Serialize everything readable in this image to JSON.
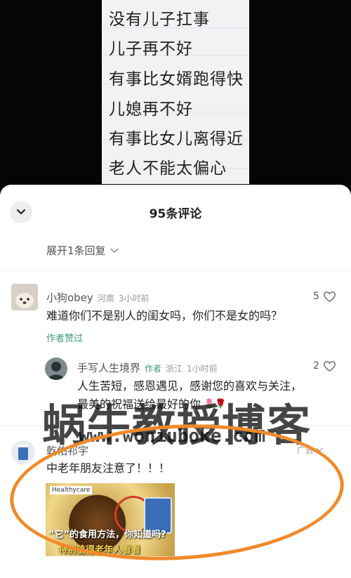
{
  "video": {
    "lines": [
      "没有儿子扛事",
      "儿子再不好",
      "有事比女婿跑得快",
      "儿媳再不好",
      "有事比女儿离得近",
      "老人不能太偏心"
    ]
  },
  "sheet": {
    "title": "95条评论",
    "expand_replies": "展开1条回复"
  },
  "comments": [
    {
      "user": "小狗obey",
      "region": "河南",
      "time": "3小时前",
      "likes": "5",
      "text": "难道你们不是别人的闺女吗，你们不是女的吗？",
      "author_liked": "作者赞过"
    }
  ],
  "reply": {
    "user": "手写人生境界",
    "author_tag": "作者",
    "region": "浙江",
    "time": "1小时前",
    "likes": "2",
    "text_line1": "人生苦短，感恩遇见，感谢您的喜欢与关注，",
    "text_line2": "最美的祝福送给最好的你"
  },
  "ad": {
    "user": "乾佑祁宇",
    "label": "广告",
    "text": "中老年朋友注意了！！！",
    "image_brand": "Healthycare",
    "image_caption1": "“它”的食用方法，你知道吗?",
    "image_caption2": "特别值得老年人看看"
  },
  "watermark": {
    "line1": "蜗牛教授博客",
    "line2": "www.woniuboke.com"
  },
  "colors": {
    "accent_green": "#3b9a78",
    "ad_circle": "#f08a2a"
  }
}
